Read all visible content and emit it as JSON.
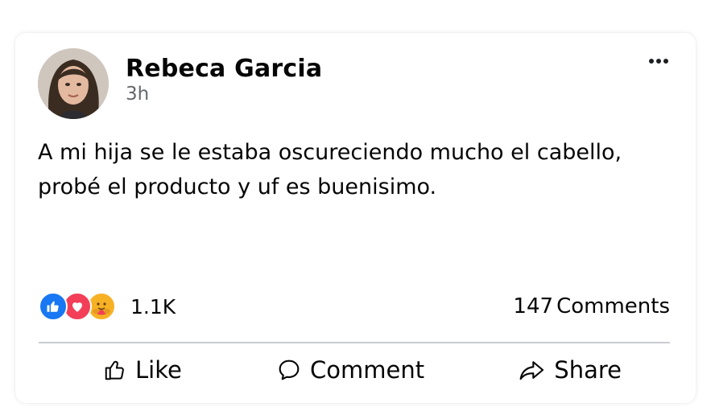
{
  "post": {
    "author": "Rebeca Garcia",
    "time": "3h",
    "text": "A mi hija se le estaba oscureciendo mucho el cabello, probé el producto y uf es buenisimo."
  },
  "reactions": {
    "types": [
      "like",
      "love",
      "care"
    ],
    "count": "1.1K"
  },
  "comments": {
    "count": "147",
    "label": "Comments"
  },
  "actions": {
    "like": "Like",
    "comment": "Comment",
    "share": "Share"
  },
  "colors": {
    "like_blue": "#1877f2",
    "love_red": "#f33e58",
    "care_yellow": "#f7b125",
    "divider": "#c9ccd1",
    "secondary_text": "#65676b"
  }
}
